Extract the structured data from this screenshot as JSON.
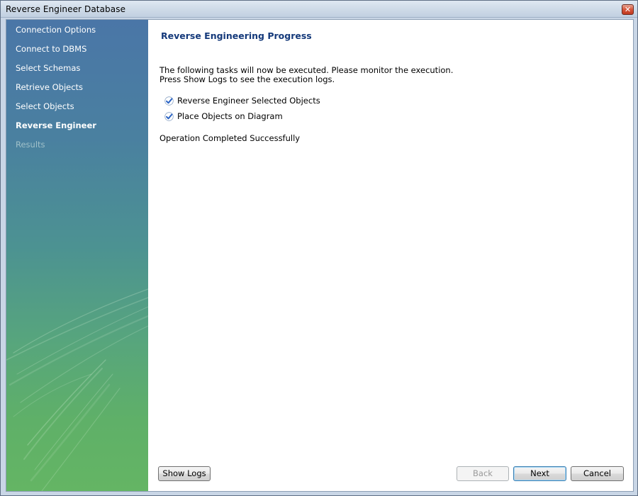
{
  "window": {
    "title": "Reverse Engineer Database",
    "close_glyph": "✕"
  },
  "sidebar": {
    "items": [
      {
        "label": "Connection Options",
        "state": "normal"
      },
      {
        "label": "Connect to DBMS",
        "state": "normal"
      },
      {
        "label": "Select Schemas",
        "state": "normal"
      },
      {
        "label": "Retrieve Objects",
        "state": "normal"
      },
      {
        "label": "Select Objects",
        "state": "normal"
      },
      {
        "label": "Reverse Engineer",
        "state": "active"
      },
      {
        "label": "Results",
        "state": "disabled"
      }
    ]
  },
  "main": {
    "title": "Reverse Engineering Progress",
    "description_line1": "The following tasks will now be executed. Please monitor the execution.",
    "description_line2": "Press Show Logs to see the execution logs.",
    "tasks": [
      {
        "label": "Reverse Engineer Selected Objects",
        "icon": "checkmark-icon",
        "done": true
      },
      {
        "label": "Place Objects on Diagram",
        "icon": "checkmark-icon",
        "done": true
      }
    ],
    "status": "Operation Completed Successfully"
  },
  "buttons": {
    "show_logs": "Show Logs",
    "back": "Back",
    "next": "Next",
    "cancel": "Cancel"
  },
  "colors": {
    "title_accent": "#14397a",
    "sidebar_top": "#4a76a7",
    "sidebar_bottom": "#64b564",
    "check_blue": "#2a63c4"
  }
}
